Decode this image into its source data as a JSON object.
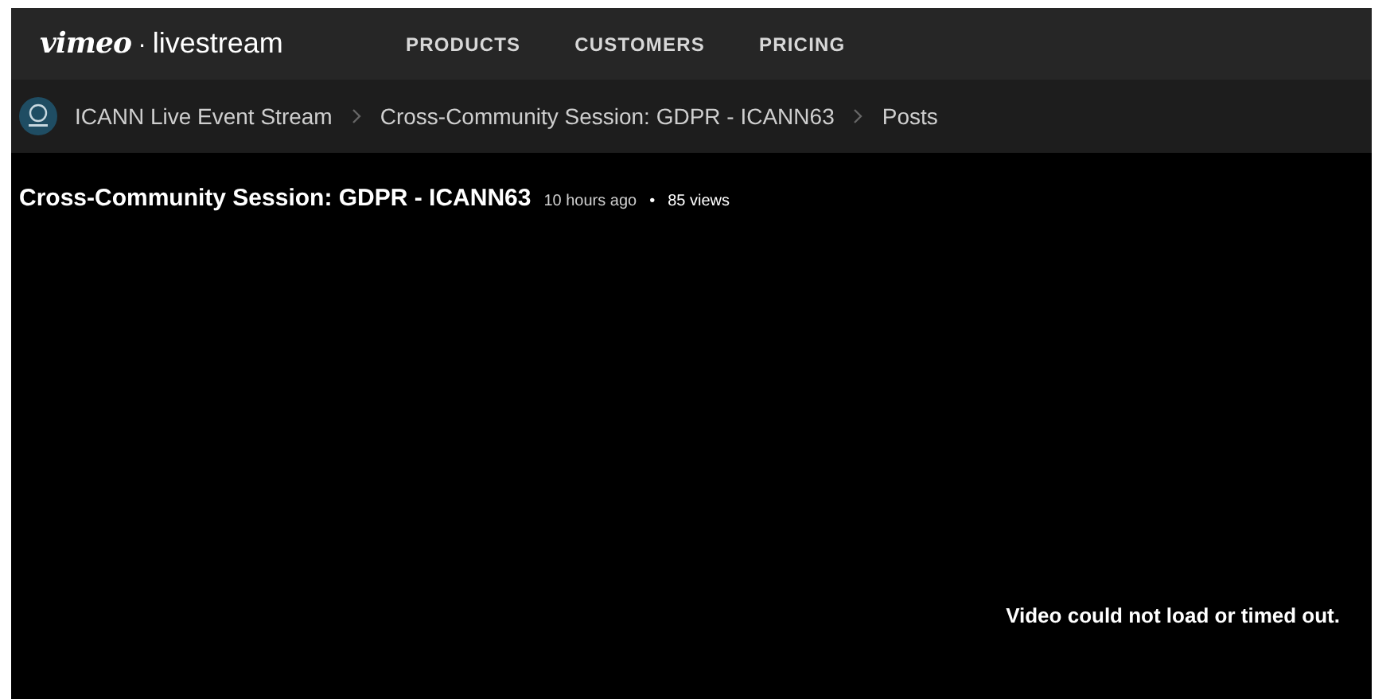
{
  "logo": {
    "brand": "vimeo",
    "separator": "·",
    "product": "livestream"
  },
  "nav": [
    {
      "label": "PRODUCTS"
    },
    {
      "label": "CUSTOMERS"
    },
    {
      "label": "PRICING"
    }
  ],
  "breadcrumb": [
    {
      "label": "ICANN Live Event Stream"
    },
    {
      "label": "Cross-Community Session: GDPR - ICANN63"
    },
    {
      "label": "Posts"
    }
  ],
  "post": {
    "title": "Cross-Community Session: GDPR - ICANN63",
    "time": "10 hours ago",
    "bullet": "•",
    "views": "85 views"
  },
  "video": {
    "message": "Video could not load or timed out."
  }
}
